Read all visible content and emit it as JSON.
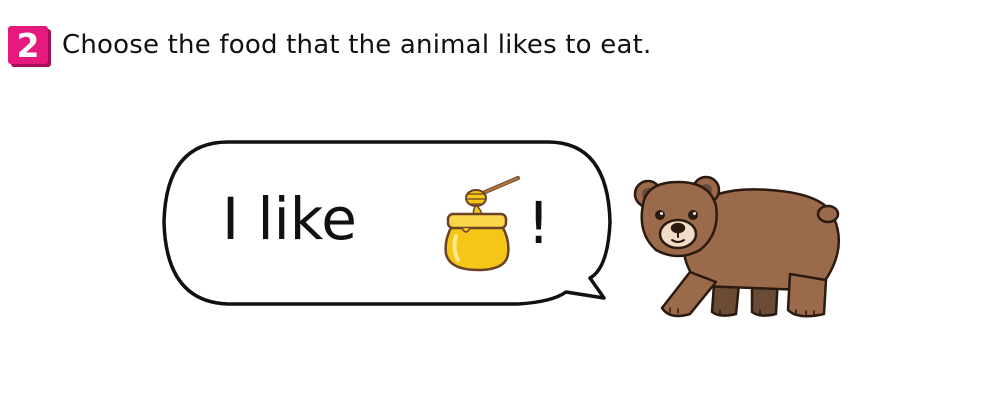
{
  "question": {
    "number": "2",
    "text": "Choose the food that the animal likes to eat."
  },
  "speech_bubble": {
    "text_before": "I like",
    "food_icon": "honey-jar-icon",
    "text_after": "!"
  },
  "animal": {
    "icon": "bear-icon"
  },
  "colors": {
    "badge": "#e6197e",
    "badge_shadow": "#a40d57",
    "honey": "#f5c518",
    "bear_fur": "#9b6a4a",
    "bear_dark": "#6b4a36"
  }
}
